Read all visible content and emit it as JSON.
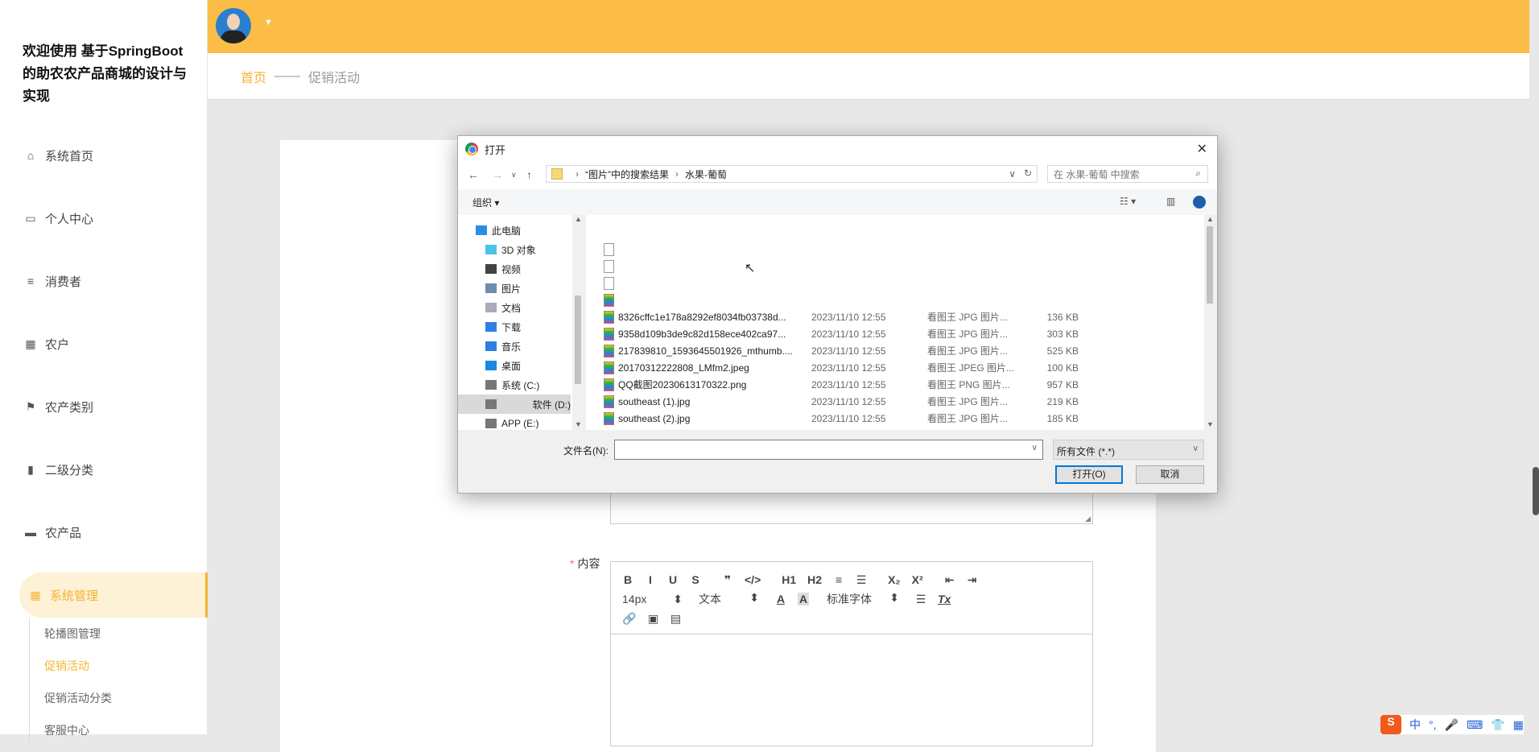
{
  "sidebar": {
    "title": "欢迎使用 基于SpringBoot的助农农产品商城的设计与实现",
    "items": [
      {
        "label": "系统首页",
        "icon": "home-icon"
      },
      {
        "label": "个人中心",
        "icon": "card-icon"
      },
      {
        "label": "消费者",
        "icon": "menu-icon"
      },
      {
        "label": "农户",
        "icon": "grid-icon"
      },
      {
        "label": "农产类别",
        "icon": "flag-icon"
      },
      {
        "label": "二级分类",
        "icon": "bar-chart-icon"
      },
      {
        "label": "农产品",
        "icon": "shop-icon"
      },
      {
        "label": "系统管理",
        "icon": "grid-icon"
      }
    ],
    "subitems": [
      {
        "label": "轮播图管理"
      },
      {
        "label": "促销活动"
      },
      {
        "label": "促销活动分类"
      },
      {
        "label": "客服中心"
      }
    ]
  },
  "header": {
    "caret": "▼"
  },
  "breadcrumb": {
    "home": "首页",
    "sep": "——",
    "current": "促销活动"
  },
  "form": {
    "content_label": "内容",
    "required": "*"
  },
  "editor": {
    "row1": [
      "B",
      "I",
      "U",
      "S",
      "❞",
      "</>",
      "H1",
      "H2",
      "≡",
      "☰",
      "X₂",
      "X²",
      "⇤",
      "⇥"
    ],
    "font_size": "14px",
    "block": "文本",
    "font_family": "标准字体",
    "clear": "Tx"
  },
  "dialog": {
    "title": "打开",
    "path": [
      "“图片”中的搜索结果",
      "水果-葡萄"
    ],
    "search_placeholder": "在 水果-葡萄 中搜索",
    "organize": "组织 ▾",
    "nav": [
      {
        "label": "此电脑",
        "color": "#2b8ee0"
      },
      {
        "label": "3D 对象",
        "color": "#4cc3e8"
      },
      {
        "label": "视频",
        "color": "#444"
      },
      {
        "label": "图片",
        "color": "#6a8fb0"
      },
      {
        "label": "文档",
        "color": "#aab"
      },
      {
        "label": "下载",
        "color": "#2f7fe0"
      },
      {
        "label": "音乐",
        "color": "#2f7fe0"
      },
      {
        "label": "桌面",
        "color": "#1a88e0"
      },
      {
        "label": "系统 (C:)",
        "color": "#777"
      },
      {
        "label": "软件 (D:)",
        "color": "#777"
      },
      {
        "label": "APP (E:)",
        "color": "#777"
      }
    ],
    "files": [
      {
        "name": "",
        "date": "",
        "type": "",
        "size": "",
        "icon": "blank"
      },
      {
        "name": "",
        "date": "",
        "type": "",
        "size": "",
        "icon": "blank"
      },
      {
        "name": "",
        "date": "",
        "type": "",
        "size": "",
        "icon": "blank"
      },
      {
        "name": "",
        "date": "",
        "type": "",
        "size": "",
        "icon": "img"
      },
      {
        "name": "8326cffc1e178a8292ef8034fb03738d...",
        "date": "2023/11/10 12:55",
        "type": "看图王 JPG 图片...",
        "size": "136 KB",
        "icon": "img"
      },
      {
        "name": "9358d109b3de9c82d158ece402ca97...",
        "date": "2023/11/10 12:55",
        "type": "看图王 JPG 图片...",
        "size": "303 KB",
        "icon": "img"
      },
      {
        "name": "217839810_1593645501926_mthumb....",
        "date": "2023/11/10 12:55",
        "type": "看图王 JPG 图片...",
        "size": "525 KB",
        "icon": "img"
      },
      {
        "name": "20170312222808_LMfm2.jpeg",
        "date": "2023/11/10 12:55",
        "type": "看图王 JPEG 图片...",
        "size": "100 KB",
        "icon": "img"
      },
      {
        "name": "QQ截图20230613170322.png",
        "date": "2023/11/10 12:55",
        "type": "看图王 PNG 图片...",
        "size": "957 KB",
        "icon": "img"
      },
      {
        "name": "southeast (1).jpg",
        "date": "2023/11/10 12:55",
        "type": "看图王 JPG 图片...",
        "size": "219 KB",
        "icon": "img"
      },
      {
        "name": "southeast (2).jpg",
        "date": "2023/11/10 12:55",
        "type": "看图王 JPG 图片...",
        "size": "185 KB",
        "icon": "img"
      }
    ],
    "filename_label": "文件名(N):",
    "filename_value": "",
    "filter": "所有文件 (*.*)",
    "open": "打开(O)",
    "cancel": "取消"
  },
  "ime": {
    "items": [
      "S",
      "中",
      "°,",
      "🎤",
      "⌨",
      "👕",
      "▦"
    ]
  }
}
